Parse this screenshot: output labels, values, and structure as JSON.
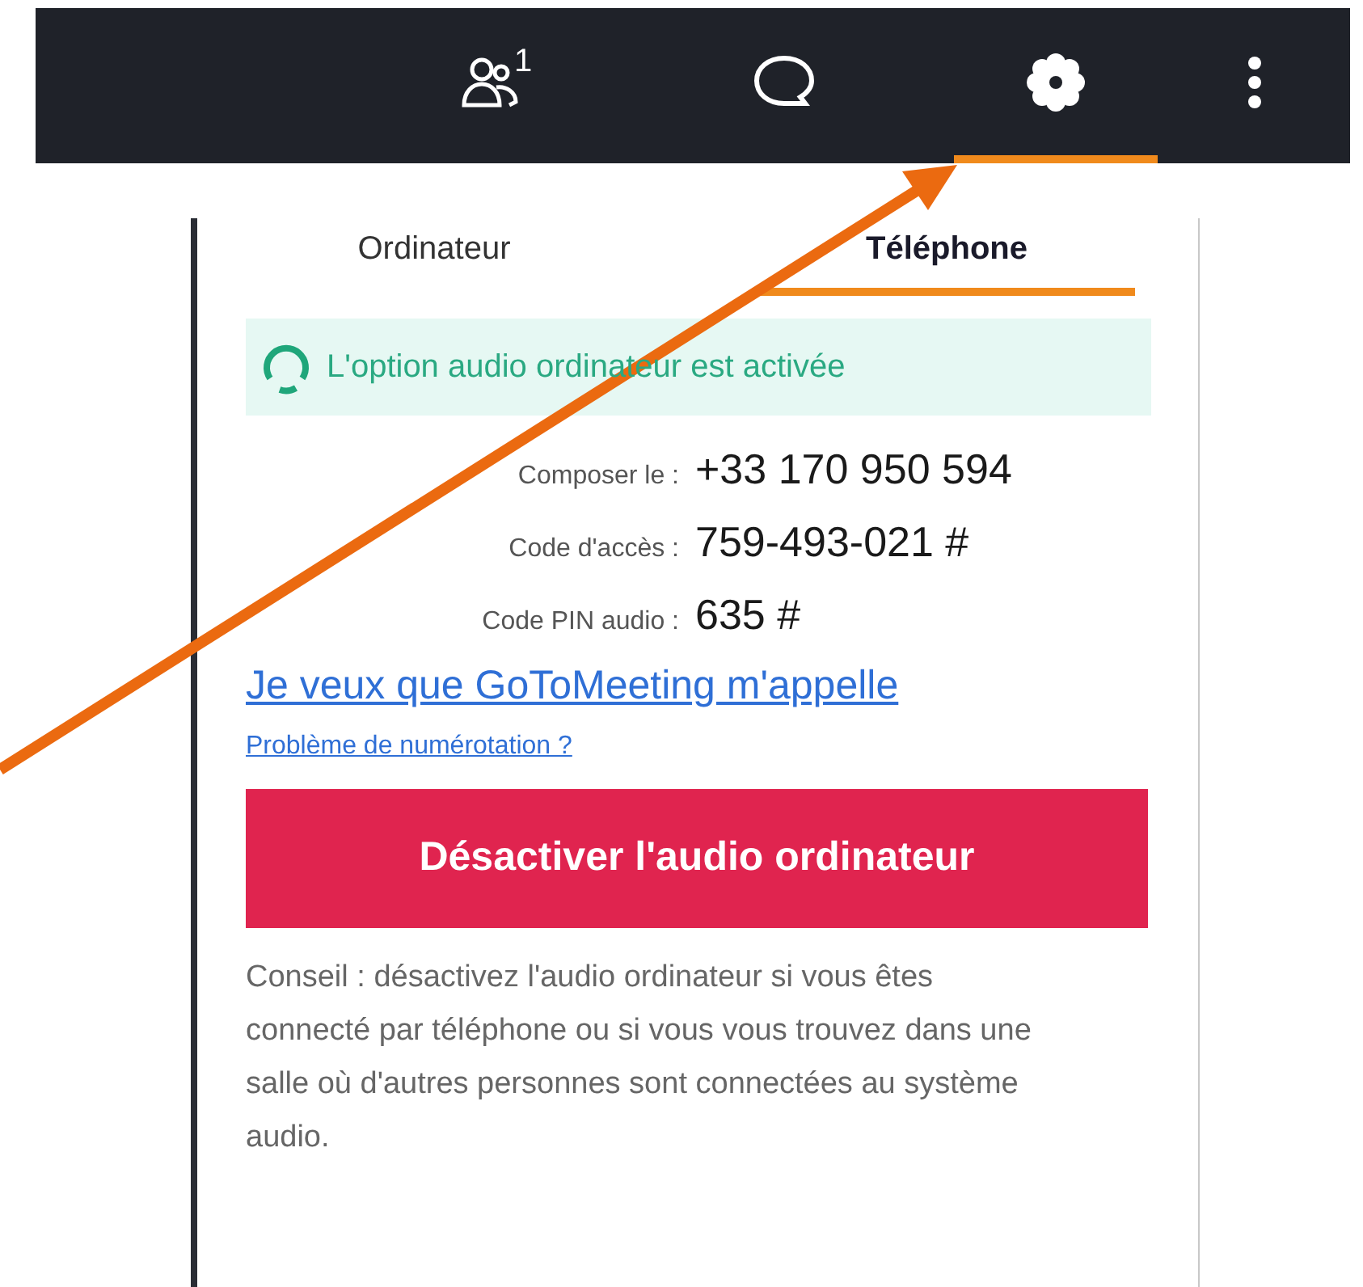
{
  "toolbar": {
    "items": [
      {
        "kind": "people",
        "badge": "1",
        "selected": false
      },
      {
        "kind": "chat",
        "selected": false
      },
      {
        "kind": "settings",
        "selected": true
      },
      {
        "kind": "more",
        "selected": false
      }
    ]
  },
  "tabs": [
    {
      "label": "Ordinateur",
      "selected": false
    },
    {
      "label": "Téléphone",
      "selected": true
    }
  ],
  "status_banner": {
    "text": "L'option audio ordinateur est activée"
  },
  "dial_info": [
    {
      "label": "Composer le :",
      "value": "+33 170 950 594"
    },
    {
      "label": "Code d'accès :",
      "value": "759-493-021 #"
    },
    {
      "label": "Code PIN audio :",
      "value": "635 #"
    }
  ],
  "call_me_link": "Je veux que GoToMeeting m'appelle",
  "help_link": "Problème de numérotation ?",
  "disable_button": "Désactiver l'audio ordinateur",
  "tip": "Conseil : désactivez l'audio ordinateur si vous êtes connecté par téléphone ou si vous vous trouvez dans une salle où d'autres personnes sont connectées au système audio."
}
